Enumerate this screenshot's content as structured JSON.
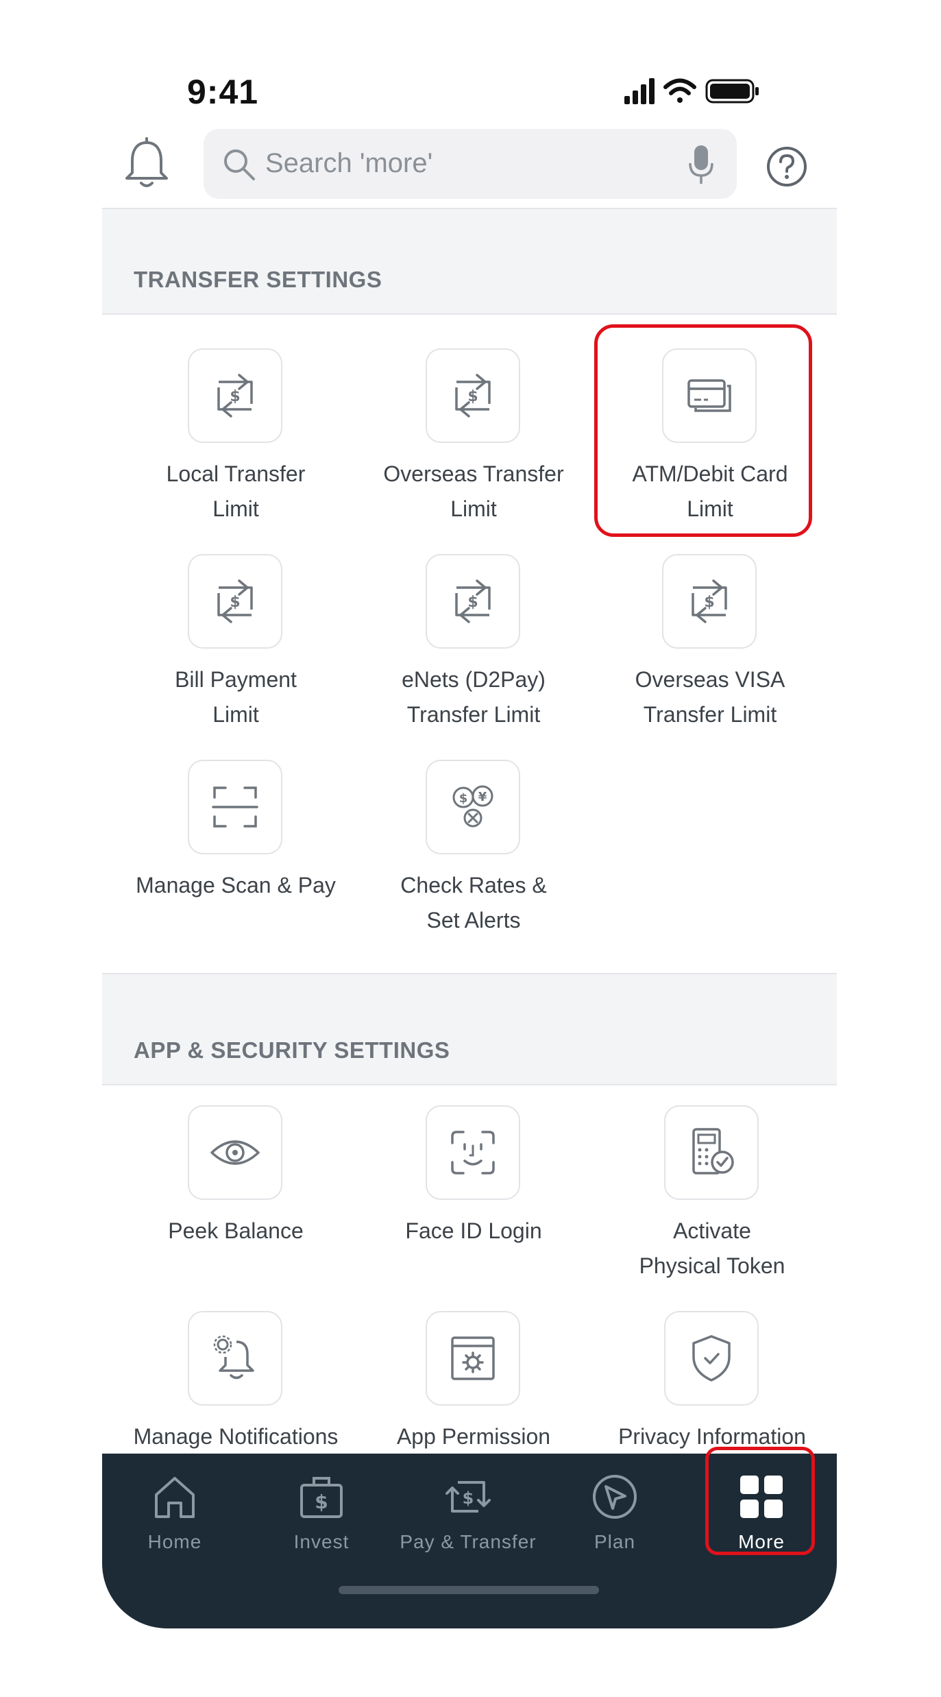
{
  "status_bar": {
    "time": "9:41"
  },
  "search": {
    "placeholder": "Search 'more'"
  },
  "sections": [
    {
      "title": "TRANSFER SETTINGS"
    },
    {
      "title": "APP & SECURITY SETTINGS"
    }
  ],
  "transfer_tiles": [
    {
      "label_line1": "Local Transfer",
      "label_line2": "Limit",
      "icon": "transfer-dollar-icon"
    },
    {
      "label_line1": "Overseas Transfer",
      "label_line2": "Limit",
      "icon": "transfer-dollar-icon"
    },
    {
      "label_line1": "ATM/Debit Card",
      "label_line2": "Limit",
      "icon": "card-icon"
    },
    {
      "label_line1": "Bill Payment",
      "label_line2": "Limit",
      "icon": "transfer-dollar-icon"
    },
    {
      "label_line1": "eNets (D2Pay)",
      "label_line2": "Transfer Limit",
      "icon": "transfer-dollar-icon"
    },
    {
      "label_line1": "Overseas VISA",
      "label_line2": "Transfer Limit",
      "icon": "transfer-dollar-icon"
    },
    {
      "label_line1": "Manage Scan & Pay",
      "label_line2": "",
      "icon": "scan-icon"
    },
    {
      "label_line1": "Check Rates &",
      "label_line2": "Set Alerts",
      "icon": "currency-rates-icon"
    }
  ],
  "security_tiles": [
    {
      "label_line1": "Peek Balance",
      "label_line2": "",
      "icon": "eye-icon"
    },
    {
      "label_line1": "Face ID Login",
      "label_line2": "",
      "icon": "face-id-icon"
    },
    {
      "label_line1": "Activate",
      "label_line2": "Physical Token",
      "icon": "token-icon"
    },
    {
      "label_line1": "Manage Notifications",
      "label_line2": "",
      "icon": "notification-settings-icon"
    },
    {
      "label_line1": "App Permission",
      "label_line2": "",
      "icon": "app-permission-icon"
    },
    {
      "label_line1": "Privacy Information",
      "label_line2": "",
      "icon": "shield-icon"
    }
  ],
  "tabs": [
    {
      "label": "Home",
      "icon": "home-icon"
    },
    {
      "label": "Invest",
      "icon": "invest-icon"
    },
    {
      "label": "Pay & Transfer",
      "icon": "pay-transfer-icon"
    },
    {
      "label": "Plan",
      "icon": "plan-icon"
    },
    {
      "label": "More",
      "icon": "more-grid-icon",
      "active": true
    }
  ],
  "colors": {
    "tab_bar": "#1d2b36",
    "highlight": "#e0111a",
    "section_bg": "#f3f4f6",
    "search_bg": "#f1f1f3"
  }
}
